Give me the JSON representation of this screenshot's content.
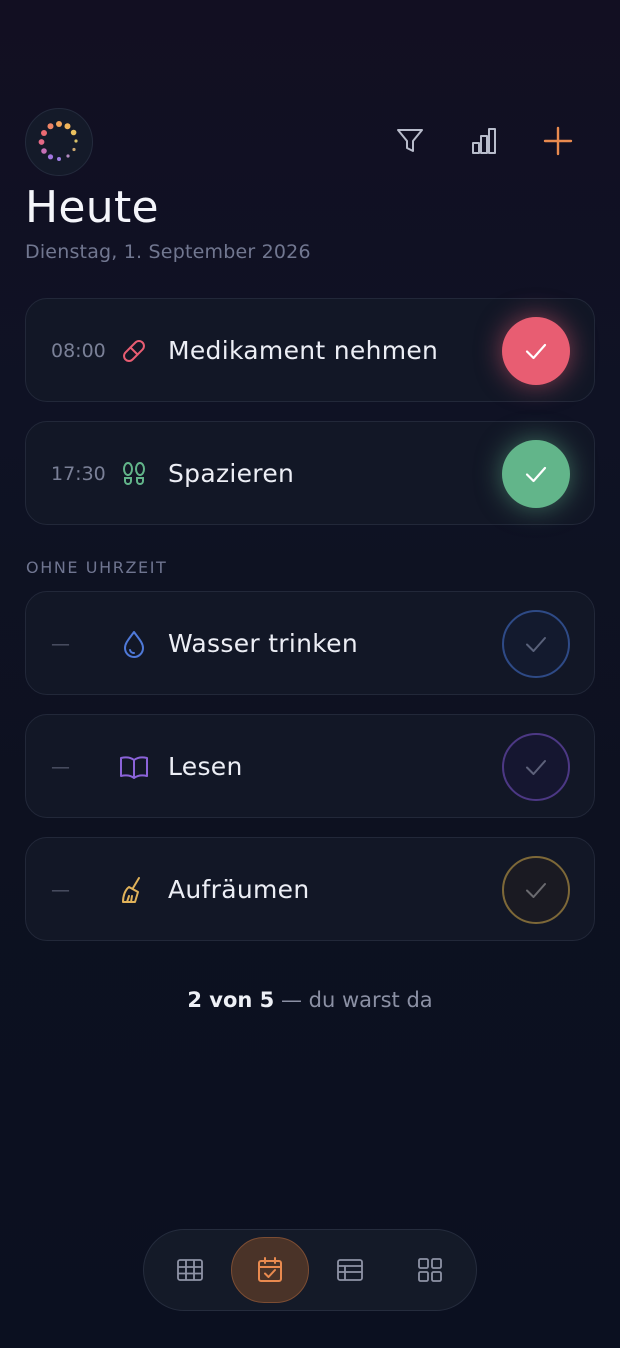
{
  "header": {
    "title": "Heute",
    "date": "Dienstag, 1. September 2026",
    "icons": [
      "progress-ring-icon",
      "filter-icon",
      "bar-chart-icon",
      "plus-icon"
    ]
  },
  "scheduled_tasks": [
    {
      "time": "08:00",
      "icon": "pill-icon",
      "label": "Medikament nehmen",
      "done": true,
      "color": "#e85d72"
    },
    {
      "time": "17:30",
      "icon": "footsteps-icon",
      "label": "Spazieren",
      "done": true,
      "color": "#62b58a"
    }
  ],
  "section": {
    "no_time_label": "OHNE UHRZEIT"
  },
  "untimed_tasks": [
    {
      "dash": "—",
      "icon": "water-drop-icon",
      "label": "Wasser trinken",
      "done": false,
      "color": "#4f79d8"
    },
    {
      "dash": "—",
      "icon": "open-book-icon",
      "label": "Lesen",
      "done": false,
      "color": "#8b63d9"
    },
    {
      "dash": "—",
      "icon": "broom-icon",
      "label": "Aufräumen",
      "done": false,
      "color": "#e0b25a"
    }
  ],
  "summary": {
    "count": "2 von 5",
    "sep": "—",
    "text": "du warst da"
  },
  "tabbar": {
    "tabs": [
      "grid-icon",
      "calendar-check-icon",
      "list-table-icon",
      "apps-icon"
    ],
    "active": 1,
    "accent": "#e98a4f"
  }
}
